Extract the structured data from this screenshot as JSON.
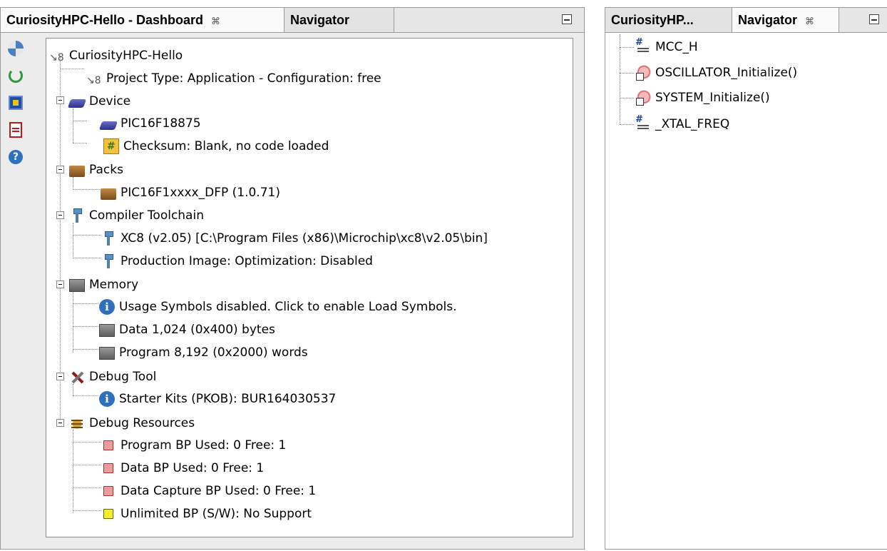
{
  "left_panel": {
    "tabs": [
      {
        "label": "CuriosityHPC-Hello - Dashboard",
        "close": "⌘"
      },
      {
        "label": "Navigator"
      }
    ],
    "tree": {
      "root": "CuriosityHPC-Hello",
      "project_type": "Project Type: Application - Configuration: free",
      "device": {
        "label": "Device",
        "items": [
          "PIC16F18875",
          "Checksum: Blank, no code loaded"
        ]
      },
      "packs": {
        "label": "Packs",
        "items": [
          "PIC16F1xxxx_DFP (1.0.71)"
        ]
      },
      "compiler": {
        "label": "Compiler Toolchain",
        "items": [
          "XC8 (v2.05) [C:\\Program Files (x86)\\Microchip\\xc8\\v2.05\\bin]",
          "Production Image: Optimization: Disabled"
        ]
      },
      "memory": {
        "label": "Memory",
        "items": [
          "Usage Symbols disabled. Click to enable Load Symbols.",
          "Data 1,024 (0x400) bytes",
          "Program 8,192 (0x2000) words"
        ]
      },
      "debug_tool": {
        "label": "Debug Tool",
        "items": [
          "Starter Kits (PKOB): BUR164030537"
        ]
      },
      "debug_resources": {
        "label": "Debug Resources",
        "items": [
          "Program BP Used: 0  Free: 1",
          "Data BP Used: 0  Free: 1",
          "Data Capture BP Used: 0  Free: 1",
          "Unlimited BP (S/W): No Support"
        ]
      }
    },
    "toolbar_icons": [
      "settings-icon",
      "refresh-icon",
      "chip-icon",
      "pdf-icon",
      "help-icon"
    ]
  },
  "right_panel": {
    "tabs": [
      {
        "label": "CuriosityHP..."
      },
      {
        "label": "Navigator",
        "close": "⌘"
      }
    ],
    "items": [
      "MCC_H",
      "OSCILLATOR_Initialize()",
      "SYSTEM_Initialize()",
      "_XTAL_FREQ"
    ]
  }
}
